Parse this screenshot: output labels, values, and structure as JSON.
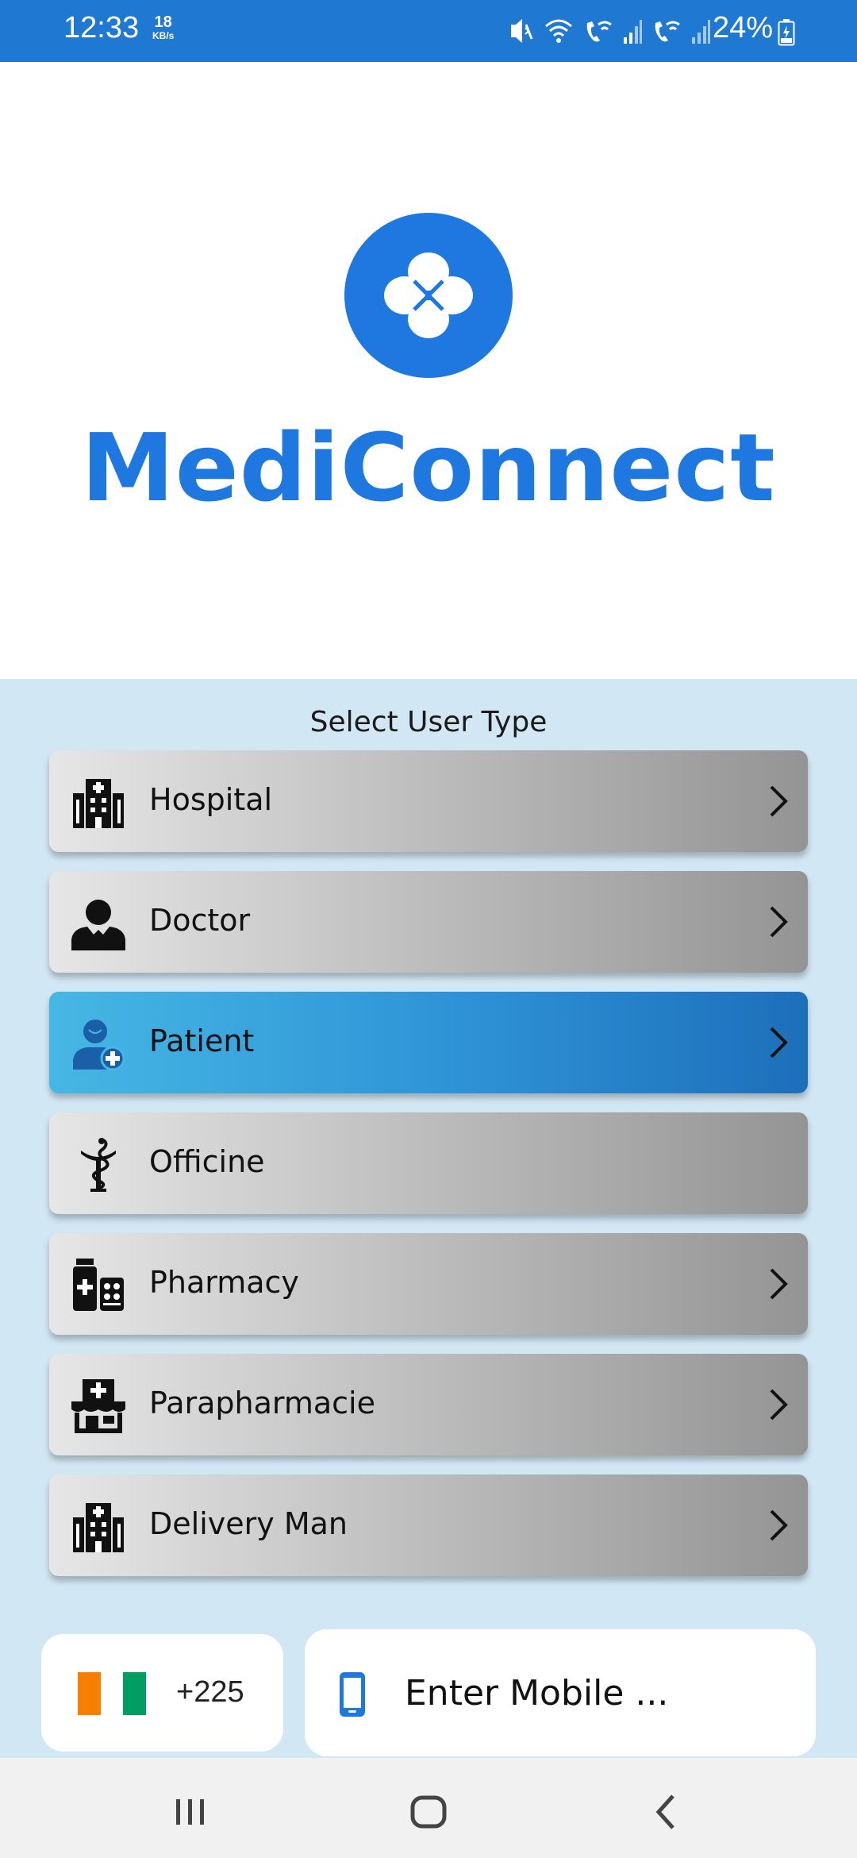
{
  "status_bar": {
    "time": "12:33",
    "speed_value": "18",
    "speed_unit": "KB/s",
    "battery_percent": "24%",
    "icons": [
      "mute-vibrate-icon",
      "wifi-icon",
      "wifi-call-icon-1",
      "signal-icon-1",
      "wifi-call-icon-2",
      "signal-icon-2",
      "battery-charging-icon"
    ]
  },
  "header": {
    "app_title": "MediConnect",
    "logo_icon": "four-petal-logo-icon",
    "brand_color": "#1f78e0"
  },
  "user_type": {
    "title": "Select User Type",
    "options": [
      {
        "label": "Hospital",
        "icon": "hospital-icon",
        "selected": false,
        "has_chevron": true
      },
      {
        "label": "Doctor",
        "icon": "doctor-icon",
        "selected": false,
        "has_chevron": true
      },
      {
        "label": "Patient",
        "icon": "patient-icon",
        "selected": true,
        "has_chevron": true
      },
      {
        "label": "Officine",
        "icon": "pharmacy-caduceus-icon",
        "selected": false,
        "has_chevron": false
      },
      {
        "label": "Pharmacy",
        "icon": "medicine-bottle-icon",
        "selected": false,
        "has_chevron": true
      },
      {
        "label": "Parapharmacie",
        "icon": "store-cross-icon",
        "selected": false,
        "has_chevron": true
      },
      {
        "label": "Delivery Man",
        "icon": "hospital-icon",
        "selected": false,
        "has_chevron": true
      }
    ]
  },
  "phone_entry": {
    "country_code": "+225",
    "flag_colors": [
      "#f77f00",
      "#ffffff",
      "#009e60"
    ],
    "placeholder": "Enter Mobile ...",
    "phone_icon": "mobile-phone-icon"
  },
  "nav_bar": {
    "buttons": [
      "recent-apps-icon",
      "home-icon",
      "back-icon"
    ]
  }
}
